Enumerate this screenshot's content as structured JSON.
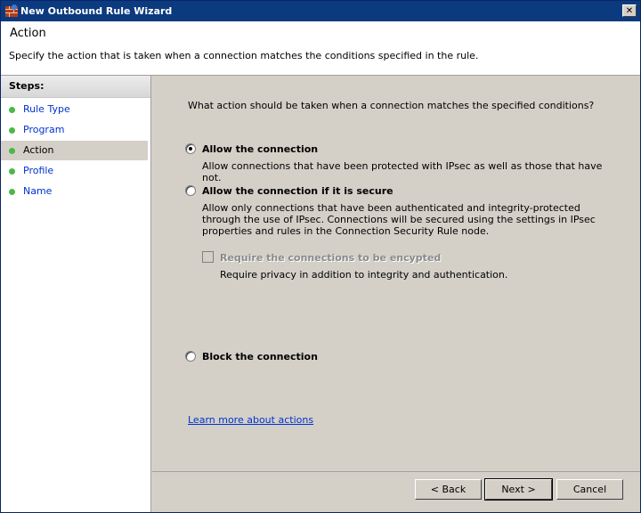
{
  "window": {
    "title": "New Outbound Rule Wizard",
    "close_label": "✕"
  },
  "header": {
    "title": "Action",
    "description": "Specify the action that is taken when a connection matches the conditions specified in the rule."
  },
  "steps": {
    "heading": "Steps:",
    "items": [
      {
        "label": "Rule Type"
      },
      {
        "label": "Program"
      },
      {
        "label": "Action"
      },
      {
        "label": "Profile"
      },
      {
        "label": "Name"
      }
    ]
  },
  "main": {
    "question": "What action should be taken when a connection matches the specified conditions?",
    "options": [
      {
        "label": "Allow the connection",
        "description": "Allow connections that have been protected with IPsec as well as those that have not.",
        "selected": true
      },
      {
        "label": "Allow the connection if it is secure",
        "description": "Allow only connections that have been authenticated and integrity-protected through the use of IPsec.  Connections will be secured using the settings in IPsec properties and rules in the Connection Security Rule node.",
        "selected": false
      },
      {
        "label": "Block the connection",
        "selected": false
      }
    ],
    "require_encryption": {
      "label": "Require the connections to be encypted",
      "description": "Require privacy in addition to integrity and authentication.",
      "checked": false,
      "disabled": true
    },
    "learn_more": "Learn more about actions"
  },
  "buttons": {
    "back": "< Back",
    "next": "Next >",
    "cancel": "Cancel"
  },
  "colors": {
    "titlebar": "#0b3a7e",
    "step_dot": "#4db848",
    "link": "#0033cc"
  }
}
